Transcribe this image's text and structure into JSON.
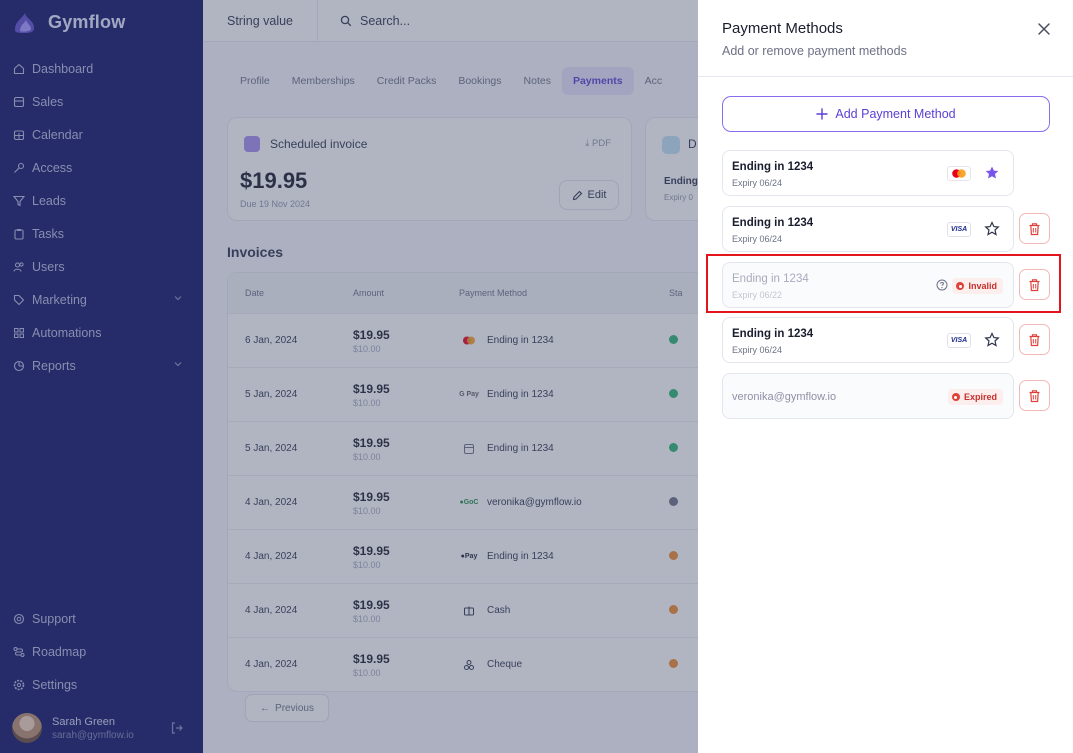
{
  "app": {
    "name": "Gymflow"
  },
  "sidebar": {
    "items": [
      {
        "label": "Dashboard",
        "icon": "home-icon"
      },
      {
        "label": "Sales",
        "icon": "receipt-icon"
      },
      {
        "label": "Calendar",
        "icon": "calendar-icon"
      },
      {
        "label": "Access",
        "icon": "key-icon"
      },
      {
        "label": "Leads",
        "icon": "funnel-icon"
      },
      {
        "label": "Tasks",
        "icon": "clipboard-icon"
      },
      {
        "label": "Users",
        "icon": "users-icon"
      },
      {
        "label": "Marketing",
        "icon": "tag-icon"
      },
      {
        "label": "Automations",
        "icon": "grid-icon"
      },
      {
        "label": "Reports",
        "icon": "chart-icon"
      }
    ],
    "bottom_items": [
      {
        "label": "Support",
        "icon": "help-icon"
      },
      {
        "label": "Roadmap",
        "icon": "roadmap-icon"
      },
      {
        "label": "Settings",
        "icon": "gear-icon"
      }
    ],
    "user": {
      "name": "Sarah Green",
      "email": "sarah@gymflow.io"
    }
  },
  "topbar": {
    "string_value": "String value",
    "search_placeholder": "Search..."
  },
  "tabs": [
    "Profile",
    "Memberships",
    "Credit Packs",
    "Bookings",
    "Notes",
    "Payments",
    "Acc"
  ],
  "active_tab": "Payments",
  "scheduled_invoice": {
    "title": "Scheduled invoice",
    "pdf_label": "PDF",
    "amount": "$19.95",
    "due": "Due 19 Nov 2024",
    "edit_label": "Edit"
  },
  "second_card": {
    "title": "D",
    "line1": "Ending",
    "line2": "Expiry 0"
  },
  "invoices": {
    "title": "Invoices",
    "columns": [
      "Date",
      "Amount",
      "Payment Method",
      "Sta"
    ],
    "rows": [
      {
        "date": "6 Jan, 2024",
        "amount": "$19.95",
        "sub": "$10.00",
        "method": "Ending in 1234",
        "method_icon": "mastercard",
        "status_color": "#2bb673"
      },
      {
        "date": "5 Jan, 2024",
        "amount": "$19.95",
        "sub": "$10.00",
        "method": "Ending in 1234",
        "method_icon": "gpay",
        "status_color": "#2bb673"
      },
      {
        "date": "5 Jan, 2024",
        "amount": "$19.95",
        "sub": "$10.00",
        "method": "Ending in 1234",
        "method_icon": "bank",
        "status_color": "#2bb673"
      },
      {
        "date": "4 Jan, 2024",
        "amount": "$19.95",
        "sub": "$10.00",
        "method": "veronika@gymflow.io",
        "method_icon": "gocardless",
        "status_color": "#6d7185"
      },
      {
        "date": "4 Jan, 2024",
        "amount": "$19.95",
        "sub": "$10.00",
        "method": "Ending in 1234",
        "method_icon": "applepay",
        "status_color": "#f08a2c"
      },
      {
        "date": "4 Jan, 2024",
        "amount": "$19.95",
        "sub": "$10.00",
        "method": "Cash",
        "method_icon": "cash",
        "status_color": "#f08a2c"
      },
      {
        "date": "4 Jan, 2024",
        "amount": "$19.95",
        "sub": "$10.00",
        "method": "Cheque",
        "method_icon": "cheque",
        "status_color": "#f08a2c"
      }
    ],
    "previous_label": "Previous"
  },
  "drawer": {
    "title": "Payment Methods",
    "subtitle": "Add or remove payment methods",
    "add_label": "Add Payment Method",
    "methods": [
      {
        "title": "Ending in 1234",
        "expiry": "Expiry 06/24",
        "brand": "mastercard",
        "default": true,
        "deletable": false
      },
      {
        "title": "Ending in 1234",
        "expiry": "Expiry 06/24",
        "brand": "VISA",
        "default": false,
        "deletable": true
      },
      {
        "title": "Ending in 1234",
        "expiry": "Expiry 06/22",
        "status": "Invalid",
        "deletable": true,
        "highlighted": true
      },
      {
        "title": "Ending in 1234",
        "expiry": "Expiry 06/24",
        "brand": "VISA",
        "default": false,
        "deletable": true
      },
      {
        "title": "veronika@gymflow.io",
        "status": "Expired",
        "deletable": true
      }
    ]
  },
  "colors": {
    "sidebar": "#0e1366",
    "accent": "#5b3fd6",
    "danger": "#e0403a",
    "highlight": "#e4141c"
  }
}
